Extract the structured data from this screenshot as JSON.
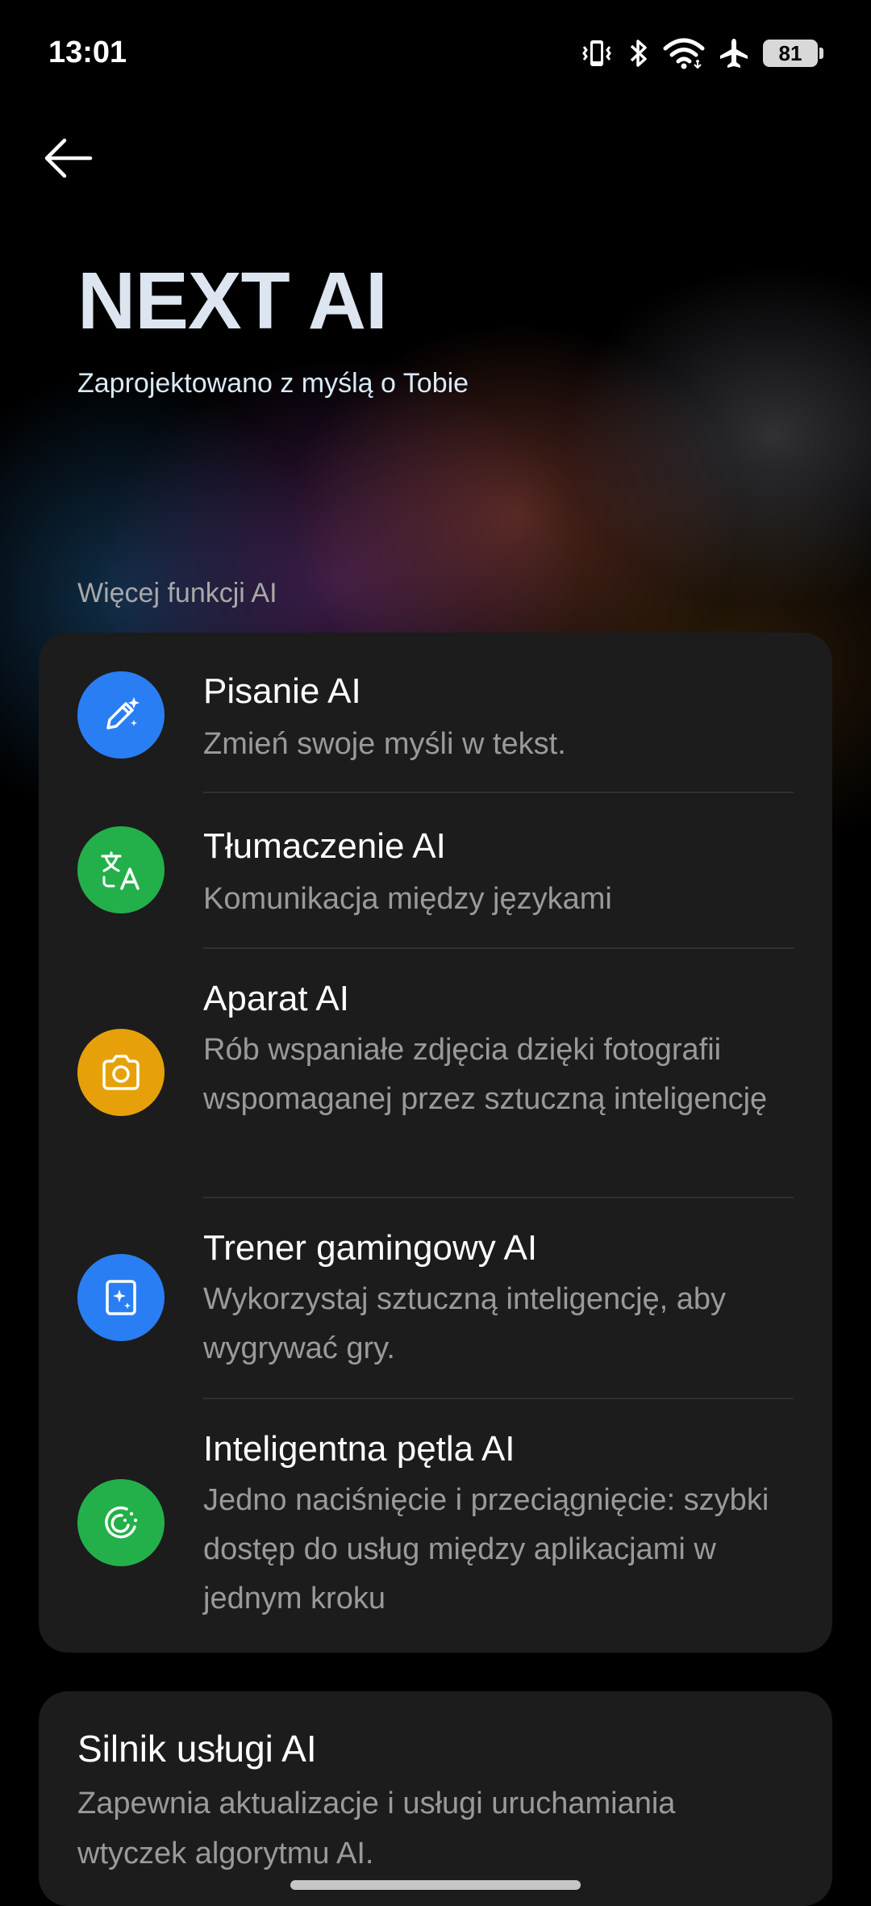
{
  "status_bar": {
    "time": "13:01",
    "battery": "81",
    "icons": [
      "vibrate-icon",
      "bluetooth-icon",
      "wifi-icon",
      "airplane-icon",
      "battery-icon"
    ]
  },
  "header": {
    "back_icon": "back-arrow-icon",
    "title": "NEXT AI",
    "subtitle": "Zaprojektowano z myślą o Tobie"
  },
  "section": {
    "label": "Więcej funkcji AI"
  },
  "features": [
    {
      "title": "Pisanie AI",
      "description": "Zmień swoje myśli w tekst.",
      "icon": "pen-sparkle-icon",
      "color": "#2a7ef4"
    },
    {
      "title": "Tłumaczenie AI",
      "description": "Komunikacja między językami",
      "icon": "translate-icon",
      "color": "#23b04a"
    },
    {
      "title": "Aparat AI",
      "description": "Rób wspaniałe zdjęcia dzięki fotografii wspomaganej przez sztuczną inteligencję",
      "icon": "camera-icon",
      "color": "#e6a10a"
    },
    {
      "title": "Trener gamingowy AI",
      "description": "Wykorzystaj sztuczną inteligencję, aby wygrywać gry.",
      "icon": "game-coach-icon",
      "color": "#2a7ef4"
    },
    {
      "title": "Inteligentna pętla AI",
      "description": "Jedno naciśnięcie i przeciągnięcie: szybki dostęp do usług między aplikacjami w jednym kroku",
      "icon": "smart-loop-icon",
      "color": "#23b04a"
    }
  ],
  "engine": {
    "title": "Silnik usługi AI",
    "description": "Zapewnia aktualizacje i usługi uruchamiania wtyczek algorytmu AI."
  }
}
